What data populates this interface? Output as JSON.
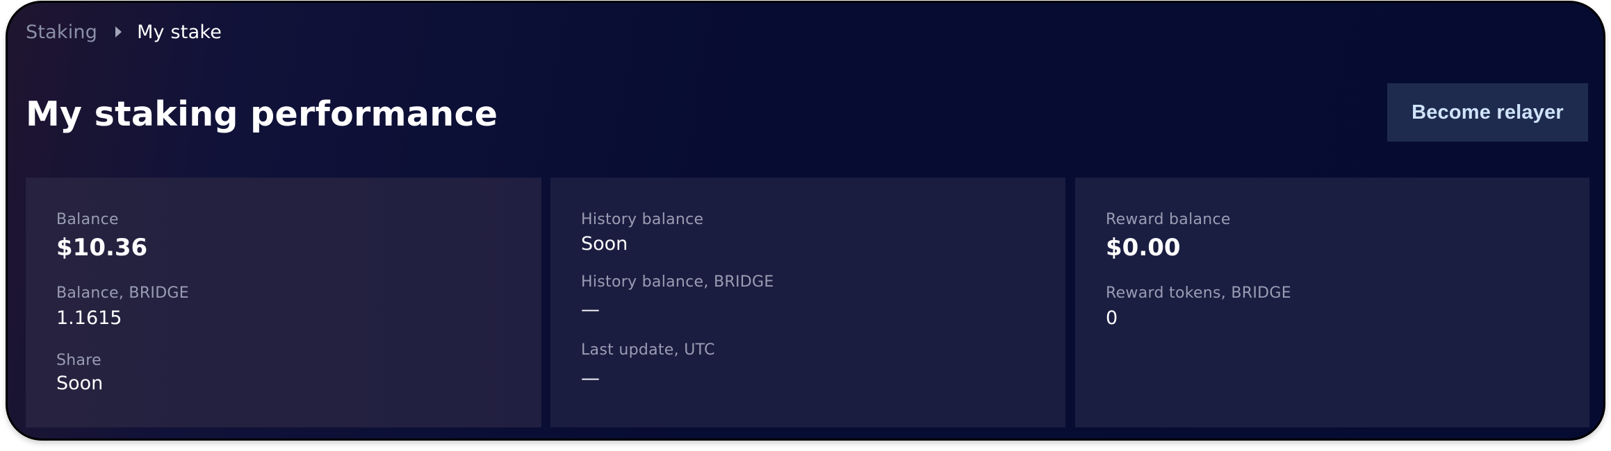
{
  "breadcrumb": {
    "root": "Staking",
    "current": "My stake"
  },
  "header": {
    "title": "My staking performance",
    "action_label": "Become relayer"
  },
  "cards": [
    {
      "fields": [
        {
          "label": "Balance",
          "value": "$10.36"
        },
        {
          "label": "Balance, BRIDGE",
          "value": "1.1615"
        },
        {
          "label": "Share",
          "value": "Soon"
        }
      ]
    },
    {
      "fields": [
        {
          "label": "History balance",
          "value": "Soon"
        },
        {
          "label": "History balance, BRIDGE",
          "value": "—"
        },
        {
          "label": "Last update, UTC",
          "value": "—"
        }
      ]
    },
    {
      "fields": [
        {
          "label": "Reward balance",
          "value": "$0.00"
        },
        {
          "label": "Reward tokens, BRIDGE",
          "value": "0"
        }
      ]
    }
  ],
  "colors": {
    "background": "#060b31",
    "card": "#1b1d40",
    "button_bg": "#1e2b4f",
    "button_text": "#cfe4fb",
    "label_text": "#9a9db4"
  },
  "icons": {
    "breadcrumb_separator": "caret-right-icon"
  }
}
